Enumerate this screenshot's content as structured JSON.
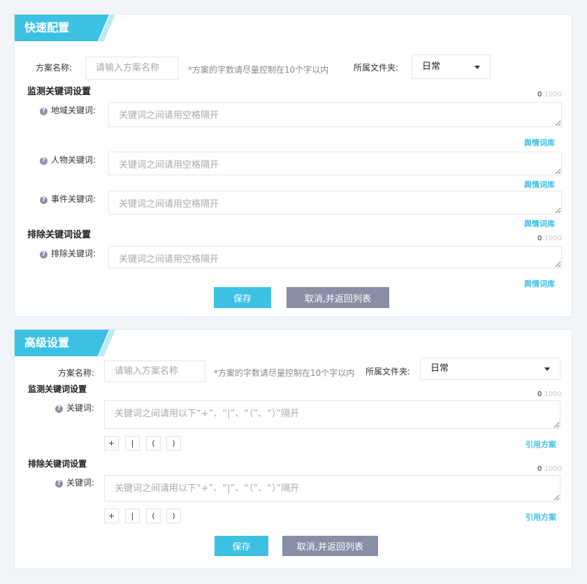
{
  "quick": {
    "title": "快速配置",
    "name_label": "方案名称:",
    "name_placeholder": "请输入方案名称",
    "name_hint": "*方案的字数请尽量控制在10个字以内",
    "folder_label": "所属文件夹:",
    "folder_value": "日常",
    "monitor_title": "监测关键词设置",
    "exclude_title": "排除关键词设置",
    "count_current": "0",
    "count_max": "1000",
    "keyword_placeholder": "关键词之间请用空格隔开",
    "fields": {
      "region": "地域关键词:",
      "person": "人物关键词:",
      "event": "事件关键词:",
      "exclude": "排除关键词:"
    },
    "lexicon_link": "舆情词库",
    "save_label": "保存",
    "cancel_label": "取消,并返回列表"
  },
  "advanced": {
    "title": "高级设置",
    "name_label": "方案名称:",
    "name_placeholder": "请输入方案名称",
    "name_hint": "*方案的字数请尽量控制在10个字以内",
    "folder_label": "所属文件夹:",
    "folder_value": "日常",
    "monitor_title": "监测关键词设置",
    "exclude_title": "排除关键词设置",
    "count_current": "0",
    "count_max": "1000",
    "keyword_label": "关键词:",
    "keyword_placeholder": "关键词之间请用以下“+”、“|”、“（”、“）”隔开",
    "symbols": [
      "+",
      "|",
      "(",
      ")"
    ],
    "cite_link": "引用方案",
    "save_label": "保存",
    "cancel_label": "取消,并返回列表"
  },
  "icons": {
    "help": "question-circle-icon",
    "dropdown": "caret-down-icon"
  },
  "colors": {
    "accent": "#3dc1e3",
    "cancel": "#878ea6"
  }
}
